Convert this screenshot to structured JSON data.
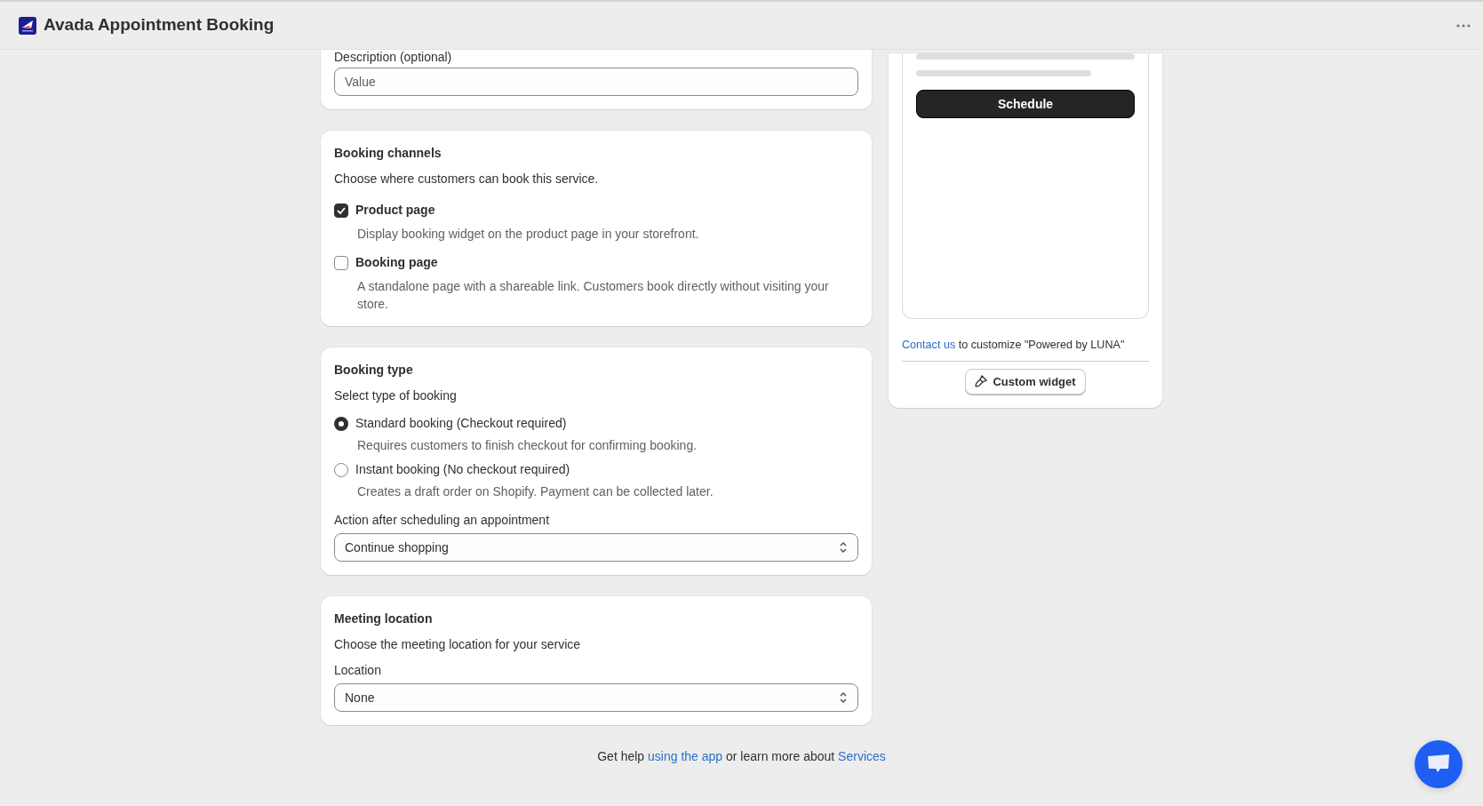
{
  "header": {
    "title": "Avada Appointment Booking"
  },
  "description": {
    "label": "Description (optional)",
    "placeholder": "Value"
  },
  "booking_channels": {
    "title": "Booking channels",
    "subtitle": "Choose where customers can book this service.",
    "options": [
      {
        "label": "Product page",
        "help": "Display booking widget on the product page in your storefront.",
        "checked": true
      },
      {
        "label": "Booking page",
        "help": "A standalone page with a shareable link. Customers book directly without visiting your store.",
        "checked": false
      }
    ]
  },
  "booking_type": {
    "title": "Booking type",
    "subtitle": "Select type of booking",
    "options": [
      {
        "label": "Standard booking (Checkout required)",
        "help": "Requires customers to finish checkout for confirming booking.",
        "selected": true
      },
      {
        "label": "Instant booking (No checkout required)",
        "help": "Creates a draft order on Shopify. Payment can be collected later.",
        "selected": false
      }
    ],
    "action": {
      "label": "Action after scheduling an appointment",
      "value": "Continue shopping"
    }
  },
  "meeting_location": {
    "title": "Meeting location",
    "subtitle": "Choose the meeting location for your service",
    "location": {
      "label": "Location",
      "value": "None"
    }
  },
  "preview": {
    "button": "Schedule",
    "note": [
      {
        "kind": "link",
        "text": "Contact us"
      },
      {
        "kind": "text",
        "text": " to customize \"Powered by LUNA\""
      }
    ],
    "custom_button": "Custom widget"
  },
  "footer": [
    {
      "kind": "text",
      "text": "Get help "
    },
    {
      "kind": "link",
      "text": "using the app"
    },
    {
      "kind": "text",
      "text": " or learn more about "
    },
    {
      "kind": "link",
      "text": "Services"
    }
  ]
}
